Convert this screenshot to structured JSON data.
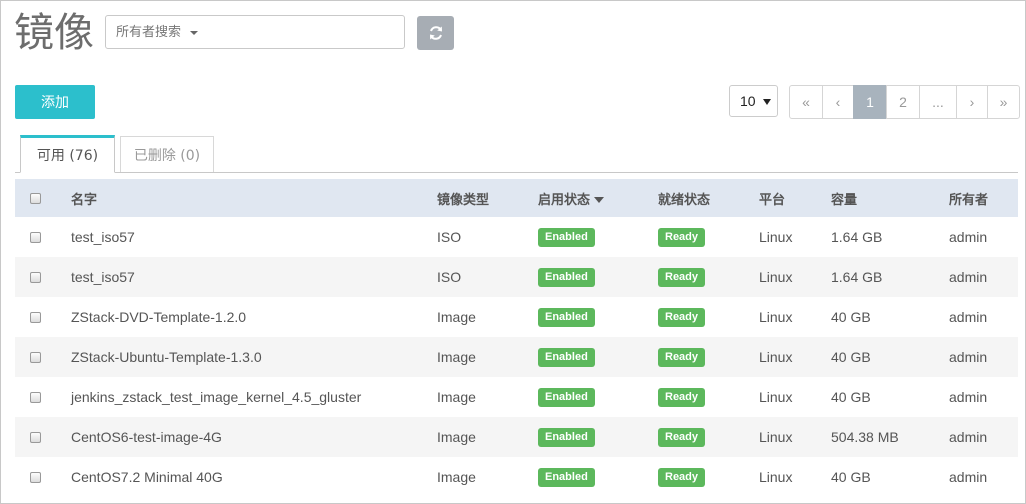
{
  "header": {
    "title": "镜像",
    "search_placeholder": "所有者搜索",
    "refresh_icon": "refresh-icon"
  },
  "toolbar": {
    "add_label": "添加",
    "page_size": "10"
  },
  "pagination": {
    "first": "«",
    "prev": "‹",
    "pages": [
      "1",
      "2",
      "..."
    ],
    "current": "1",
    "next": "›",
    "last": "»"
  },
  "tabs": {
    "available": "可用 (76)",
    "deleted": "已删除 (0)"
  },
  "table": {
    "headers": {
      "name": "名字",
      "type": "镜像类型",
      "enabled": "启用状态",
      "ready": "就绪状态",
      "platform": "平台",
      "size": "容量",
      "owner": "所有者"
    },
    "rows": [
      {
        "name": "test_iso57",
        "type": "ISO",
        "enabled": "Enabled",
        "ready": "Ready",
        "platform": "Linux",
        "size": "1.64 GB",
        "owner": "admin"
      },
      {
        "name": "test_iso57",
        "type": "ISO",
        "enabled": "Enabled",
        "ready": "Ready",
        "platform": "Linux",
        "size": "1.64 GB",
        "owner": "admin"
      },
      {
        "name": "ZStack-DVD-Template-1.2.0",
        "type": "Image",
        "enabled": "Enabled",
        "ready": "Ready",
        "platform": "Linux",
        "size": "40 GB",
        "owner": "admin"
      },
      {
        "name": "ZStack-Ubuntu-Template-1.3.0",
        "type": "Image",
        "enabled": "Enabled",
        "ready": "Ready",
        "platform": "Linux",
        "size": "40 GB",
        "owner": "admin"
      },
      {
        "name": "jenkins_zstack_test_image_kernel_4.5_gluster",
        "type": "Image",
        "enabled": "Enabled",
        "ready": "Ready",
        "platform": "Linux",
        "size": "40 GB",
        "owner": "admin"
      },
      {
        "name": "CentOS6-test-image-4G",
        "type": "Image",
        "enabled": "Enabled",
        "ready": "Ready",
        "platform": "Linux",
        "size": "504.38 MB",
        "owner": "admin"
      },
      {
        "name": "CentOS7.2 Minimal 40G",
        "type": "Image",
        "enabled": "Enabled",
        "ready": "Ready",
        "platform": "Linux",
        "size": "40 GB",
        "owner": "admin"
      }
    ]
  },
  "colors": {
    "accent": "#2cbfcc",
    "badge_green": "#5cb85c",
    "header_row": "#e0e7f1",
    "active_page": "#a8b3bd"
  }
}
